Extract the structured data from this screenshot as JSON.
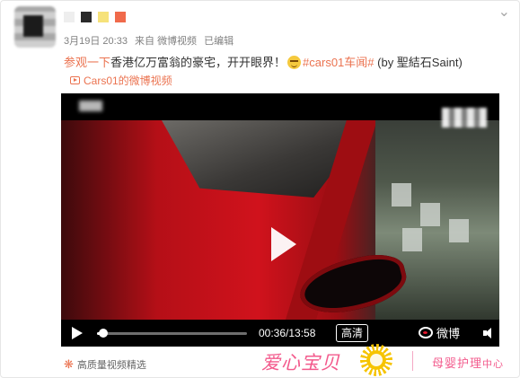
{
  "post": {
    "more_icon": "chevron-down-icon",
    "meta": {
      "date": "3月19日 20:33",
      "source_prefix": "来自",
      "source": "微博视频",
      "status": "已编辑"
    },
    "content": {
      "link_text": "参观一下",
      "main_text": "香港亿万富翁的豪宅，开开眼界！",
      "hashtag": "#cars01车闻#",
      "credit": "(by 聖結石Saint)"
    },
    "video_source": {
      "label": "Cars01的微博视频",
      "icon": "video-icon"
    }
  },
  "player": {
    "time": "00:36/13:58",
    "progress": 0.043,
    "quality": "高清",
    "logo_text": "微博",
    "icons": [
      "play-icon",
      "volume-icon",
      "weibo-logo-icon"
    ]
  },
  "footer": {
    "label": "高质量视频精选",
    "icon": "snowflake-icon"
  },
  "watermark": {
    "left_text": "爱心宝贝",
    "right_text": "母婴护理",
    "right_small": "中心",
    "logo": "sun-logo-icon",
    "colors": {
      "pink": "#f35a8c",
      "yellow": "#f6c400"
    }
  },
  "colors": {
    "accent": "#eb7350",
    "player_bg": "#000000"
  }
}
